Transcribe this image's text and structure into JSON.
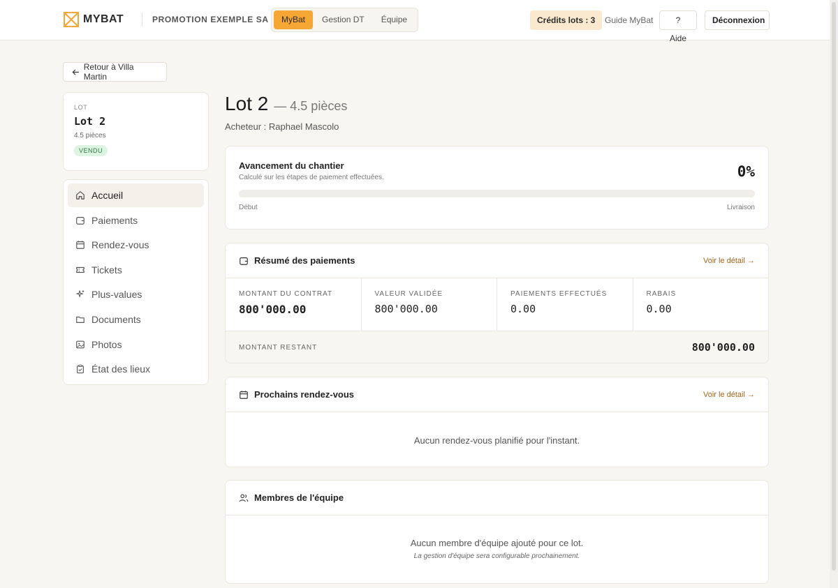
{
  "header": {
    "brand": "MYBAT",
    "company": "PROMOTION EXEMPLE SA",
    "tabs": [
      {
        "label": "MyBat",
        "active": true
      },
      {
        "label": "Gestion DT",
        "active": false
      },
      {
        "label": "Équipe",
        "active": false
      }
    ],
    "credits": "Crédits lots : 3",
    "guide": "Guide MyBat",
    "help": "? Aide",
    "logout": "Déconnexion"
  },
  "back": {
    "label": "Retour à Villa Martin"
  },
  "lot_card": {
    "kicker": "LOT",
    "title": "Lot 2",
    "rooms": "4.5 pièces",
    "status": "VENDU"
  },
  "sidebar": {
    "items": [
      {
        "label": "Accueil",
        "icon": "home-icon",
        "active": true
      },
      {
        "label": "Paiements",
        "icon": "wallet-icon",
        "active": false
      },
      {
        "label": "Rendez-vous",
        "icon": "calendar-icon",
        "active": false
      },
      {
        "label": "Tickets",
        "icon": "ticket-icon",
        "active": false
      },
      {
        "label": "Plus-values",
        "icon": "sparkles-icon",
        "active": false
      },
      {
        "label": "Documents",
        "icon": "folder-icon",
        "active": false
      },
      {
        "label": "Photos",
        "icon": "image-icon",
        "active": false
      },
      {
        "label": "État des lieux",
        "icon": "clipboard-icon",
        "active": false
      }
    ]
  },
  "main": {
    "title": "Lot 2",
    "subtitle": "— 4.5 pièces",
    "buyer": "Acheteur : Raphael Mascolo",
    "progress": {
      "title": "Avancement du chantier",
      "description": "Calculé sur les étapes de paiement effectuées.",
      "percent_label": "0%",
      "percent": 0,
      "start_label": "Début",
      "end_label": "Livraison"
    },
    "payments": {
      "title": "Résumé des paiements",
      "link": "Voir le détail →",
      "kpis": [
        {
          "label": "MONTANT DU CONTRAT",
          "value": "800'000.00"
        },
        {
          "label": "VALEUR VALIDÉE",
          "value": "800'000.00"
        },
        {
          "label": "PAIEMENTS EFFECTUÉS",
          "value": "0.00"
        },
        {
          "label": "RABAIS",
          "value": "0.00"
        }
      ],
      "remaining_label": "MONTANT RESTANT",
      "remaining_value": "800'000.00"
    },
    "appointments": {
      "title": "Prochains rendez-vous",
      "link": "Voir le détail →",
      "empty": "Aucun rendez-vous planifié pour l'instant."
    },
    "team": {
      "title": "Membres de l'équipe",
      "empty": "Aucun membre d'équipe ajouté pour ce lot.",
      "note": "La gestion d'équipe sera configurable prochainement."
    }
  },
  "colors": {
    "accent": "#f6a635",
    "background": "#f8f6f1",
    "link": "#a5631a",
    "badge_bg": "#dcf4e1",
    "badge_text": "#2f7a45"
  }
}
